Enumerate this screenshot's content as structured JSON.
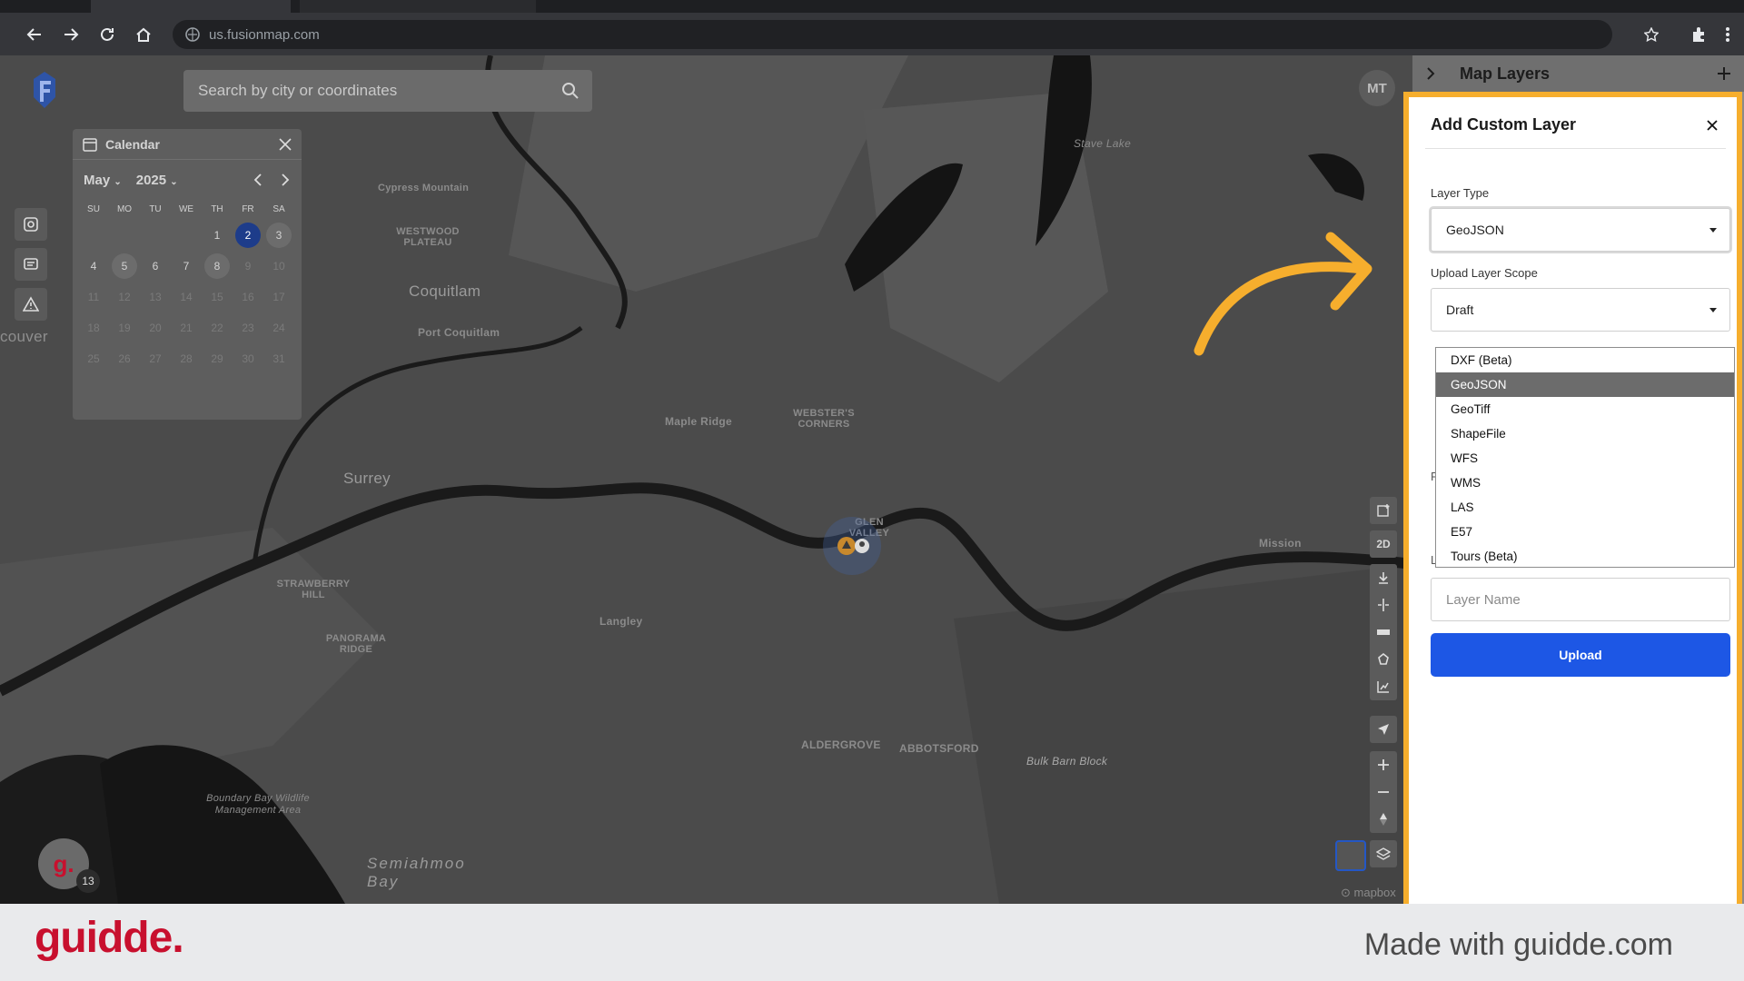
{
  "browser": {
    "url": "us.fusionmap.com"
  },
  "map": {
    "search_placeholder": "Search by city or coordinates",
    "user_initials": "MT",
    "labels": [
      "Cypress Mountain",
      "WESTWOOD PLATEAU",
      "Coquitlam",
      "Port Coquitlam",
      "Surrey",
      "STRAWBERRY HILL",
      "PANORAMA RIDGE",
      "WEBSTER'S CORNERS",
      "Maple Ridge",
      "Langley",
      "Bulk Barn Block",
      "ALDERGROVE",
      "ABBOTSFORD",
      "Semiahmoo Bay",
      "Boundary Bay Wildlife Management Area",
      "Mission",
      "GLEN VALLEY",
      "Stave Lake",
      "couver"
    ],
    "controls": [
      "2D"
    ],
    "badge_letter": "g.",
    "badge_count": "13",
    "attribution": "mapbox"
  },
  "calendar": {
    "title": "Calendar",
    "month": "May",
    "year": "2025",
    "weekdays": [
      "SU",
      "MO",
      "TU",
      "WE",
      "TH",
      "FR",
      "SA"
    ],
    "days": [
      {
        "d": "",
        "s": ""
      },
      {
        "d": "",
        "s": ""
      },
      {
        "d": "",
        "s": ""
      },
      {
        "d": "",
        "s": ""
      },
      {
        "d": "1",
        "s": ""
      },
      {
        "d": "2",
        "s": "sel"
      },
      {
        "d": "3",
        "s": "hl"
      },
      {
        "d": "4",
        "s": ""
      },
      {
        "d": "5",
        "s": "hl"
      },
      {
        "d": "6",
        "s": ""
      },
      {
        "d": "7",
        "s": ""
      },
      {
        "d": "8",
        "s": "hl"
      },
      {
        "d": "9",
        "s": "dim"
      },
      {
        "d": "10",
        "s": "dim"
      },
      {
        "d": "11",
        "s": "dim"
      },
      {
        "d": "12",
        "s": "dim"
      },
      {
        "d": "13",
        "s": "dim"
      },
      {
        "d": "14",
        "s": "dim"
      },
      {
        "d": "15",
        "s": "dim"
      },
      {
        "d": "16",
        "s": "dim"
      },
      {
        "d": "17",
        "s": "dim"
      },
      {
        "d": "18",
        "s": "dim"
      },
      {
        "d": "19",
        "s": "dim"
      },
      {
        "d": "20",
        "s": "dim"
      },
      {
        "d": "21",
        "s": "dim"
      },
      {
        "d": "22",
        "s": "dim"
      },
      {
        "d": "23",
        "s": "dim"
      },
      {
        "d": "24",
        "s": "dim"
      },
      {
        "d": "25",
        "s": "dim"
      },
      {
        "d": "26",
        "s": "dim"
      },
      {
        "d": "27",
        "s": "dim"
      },
      {
        "d": "28",
        "s": "dim"
      },
      {
        "d": "29",
        "s": "dim"
      },
      {
        "d": "30",
        "s": "dim"
      },
      {
        "d": "31",
        "s": "dim"
      }
    ]
  },
  "panel": {
    "title": "Map Layers"
  },
  "dialog": {
    "title": "Add Custom Layer",
    "layer_type_label": "Layer Type",
    "layer_type_value": "GeoJSON",
    "scope_label": "Upload Layer Scope",
    "scope_value": "Draft",
    "options": [
      "DXF (Beta)",
      "GeoJSON",
      "GeoTiff",
      "ShapeFile",
      "WFS",
      "WMS",
      "LAS",
      "E57",
      "Tours (Beta)"
    ],
    "active_option": "GeoJSON",
    "layer_name_placeholder": "Layer Name",
    "upload_label": "Upload",
    "stray_1": "F",
    "stray_2": "L"
  },
  "footer": {
    "brand": "guidde.",
    "made_with": "Made with guidde.com"
  },
  "colors": {
    "accent_blue": "#1d57e5",
    "highlight_orange": "#f6ae2d",
    "brand_red": "#c8102e"
  }
}
